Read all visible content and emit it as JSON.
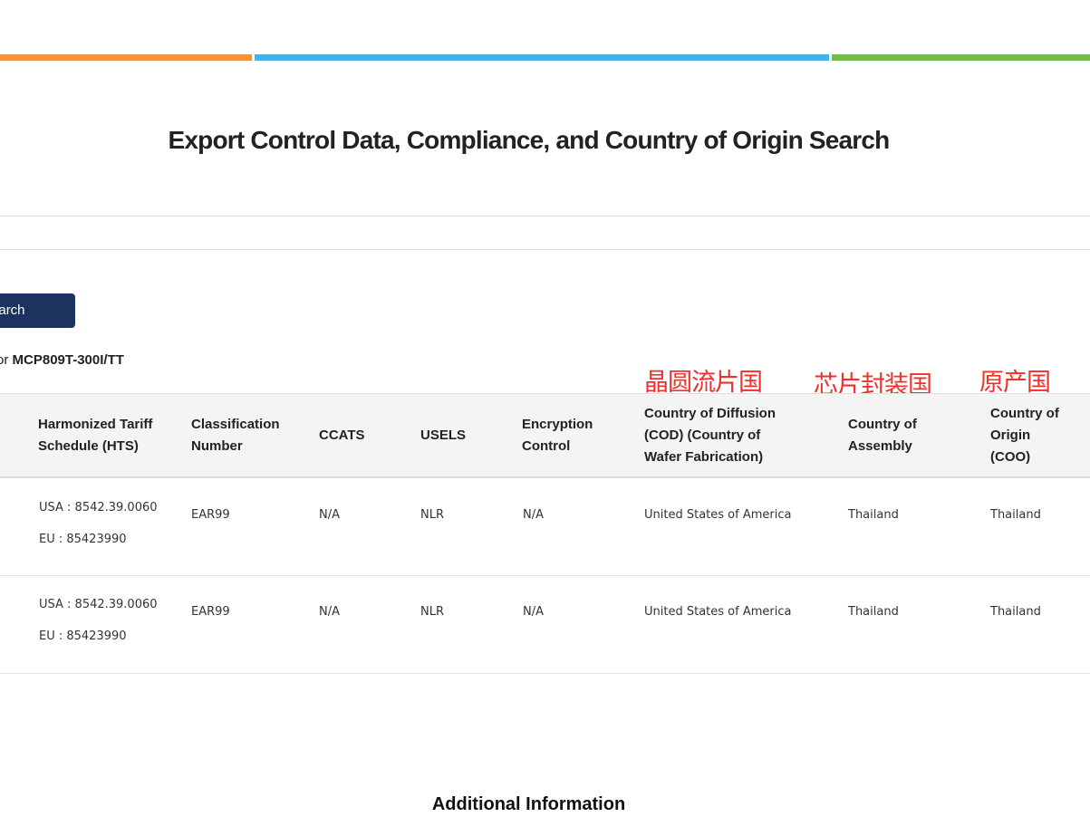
{
  "page": {
    "title": "Export Control Data, Compliance, and Country of Origin Search",
    "colors": {
      "orange": "#f39536",
      "blue": "#45b2e5",
      "green": "#72bb4c",
      "button": "#1b335e",
      "annotation": "#f0302a"
    }
  },
  "search": {
    "button_label": "Search"
  },
  "results": {
    "prefix": "or",
    "part_number": "MCP809T-300I/TT"
  },
  "annotations": {
    "wafer_fab": "晶圆流片国",
    "assembly": "芯片封装国",
    "origin": "原产国"
  },
  "table": {
    "headers": {
      "hts": [
        "Harmonized Tariff",
        "Schedule (HTS)"
      ],
      "classification": [
        "Classification",
        "Number"
      ],
      "ccats": [
        "CCATS"
      ],
      "usels": [
        "USELS"
      ],
      "encryption": [
        "Encryption",
        "Control"
      ],
      "cod": [
        "Country of Diffusion",
        "(COD) (Country of",
        "Wafer Fabrication)"
      ],
      "assembly": [
        "Country of",
        "Assembly"
      ],
      "coo": [
        "Country of",
        "Origin",
        "(COO)"
      ]
    },
    "rows": [
      {
        "hts_usa": "USA : 8542.39.0060",
        "hts_eu": "EU : 85423990",
        "classification": "EAR99",
        "ccats": "N/A",
        "usels": "NLR",
        "encryption": "N/A",
        "cod": "United States of America",
        "assembly": "Thailand",
        "coo": "Thailand"
      },
      {
        "hts_usa": "USA : 8542.39.0060",
        "hts_eu": "EU : 85423990",
        "classification": "EAR99",
        "ccats": "N/A",
        "usels": "NLR",
        "encryption": "N/A",
        "cod": "United States of America",
        "assembly": "Thailand",
        "coo": "Thailand"
      }
    ]
  },
  "footer": {
    "additional_title": "Additional Information"
  }
}
